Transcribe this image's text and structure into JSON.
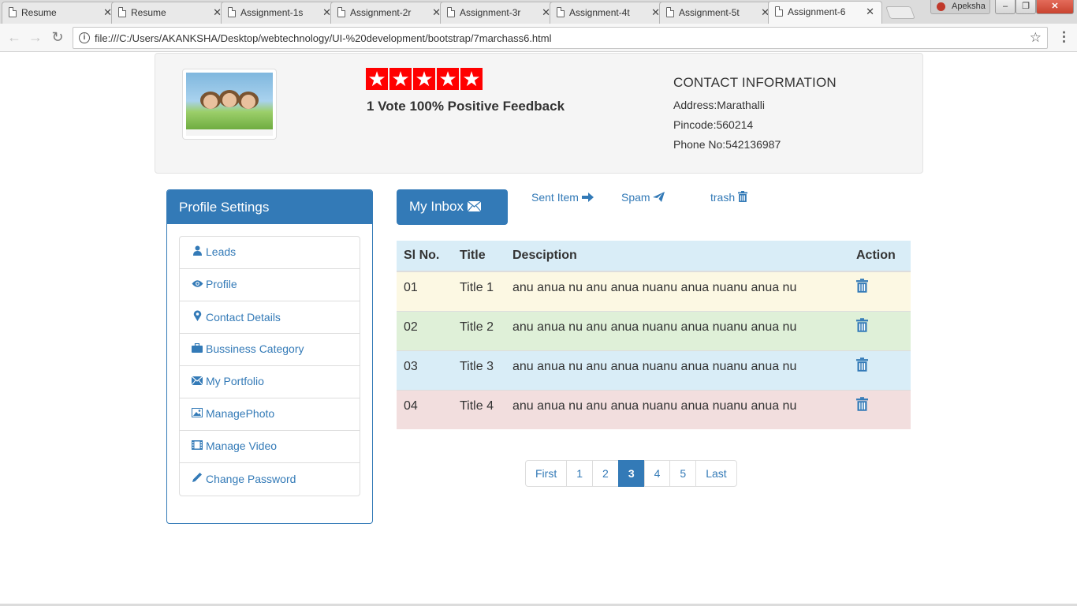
{
  "browser": {
    "tabs": [
      {
        "title": "Resume"
      },
      {
        "title": "Resume"
      },
      {
        "title": "Assignment-1s"
      },
      {
        "title": "Assignment-2r"
      },
      {
        "title": "Assignment-3r"
      },
      {
        "title": "Assignment-4t"
      },
      {
        "title": "Assignment-5t"
      },
      {
        "title": "Assignment-6"
      }
    ],
    "active_tab": 7,
    "profile_name": "Apeksha",
    "url": "file:///C:/Users/AKANKSHA/Desktop/webtechnology/UI-%20development/bootstrap/7marchass6.html"
  },
  "header": {
    "rating_stars": 5,
    "feedback": "1 Vote 100% Positive Feedback",
    "contact_title": "CONTACT INFORMATION",
    "address": "Address:Marathalli",
    "pincode": "Pincode:560214",
    "phone": "Phone No:542136987"
  },
  "sidebar": {
    "heading": "Profile Settings",
    "items": [
      {
        "label": "Leads",
        "icon": "user-icon"
      },
      {
        "label": "Profile",
        "icon": "eye-icon"
      },
      {
        "label": "Contact Details",
        "icon": "map-marker-icon"
      },
      {
        "label": "Bussiness Category",
        "icon": "briefcase-icon"
      },
      {
        "label": "My Portfolio",
        "icon": "envelope-icon"
      },
      {
        "label": "ManagePhoto",
        "icon": "picture-icon"
      },
      {
        "label": "Manage Video",
        "icon": "film-icon"
      },
      {
        "label": "Change Password",
        "icon": "pencil-icon"
      }
    ]
  },
  "mail": {
    "inbox_label": "My Inbox",
    "sent_label": "Sent Item",
    "spam_label": "Spam",
    "trash_label": "trash",
    "columns": [
      "Sl No.",
      "Title",
      "Desciption",
      "Action"
    ],
    "rows": [
      {
        "sl": "01",
        "title": "Title 1",
        "desc": "anu anua nu anu anua nuanu anua nuanu anua nu",
        "style": "warning"
      },
      {
        "sl": "02",
        "title": "Title 2",
        "desc": "anu anua nu anu anua nuanu anua nuanu anua nu",
        "style": "success"
      },
      {
        "sl": "03",
        "title": "Title 3",
        "desc": "anu anua nu anu anua nuanu anua nuanu anua nu",
        "style": "info"
      },
      {
        "sl": "04",
        "title": "Title 4",
        "desc": "anu anua nu anu anua nuanu anua nuanu anua nu",
        "style": "danger"
      }
    ]
  },
  "pagination": {
    "first": "First",
    "pages": [
      "1",
      "2",
      "3",
      "4",
      "5"
    ],
    "active_page": "3",
    "last": "Last"
  },
  "colors": {
    "primary": "#337ab7",
    "star_red": "#ff0000",
    "warning_row": "#fcf8e3",
    "success_row": "#dff0d8",
    "info_row": "#d9edf7",
    "danger_row": "#f2dede"
  }
}
